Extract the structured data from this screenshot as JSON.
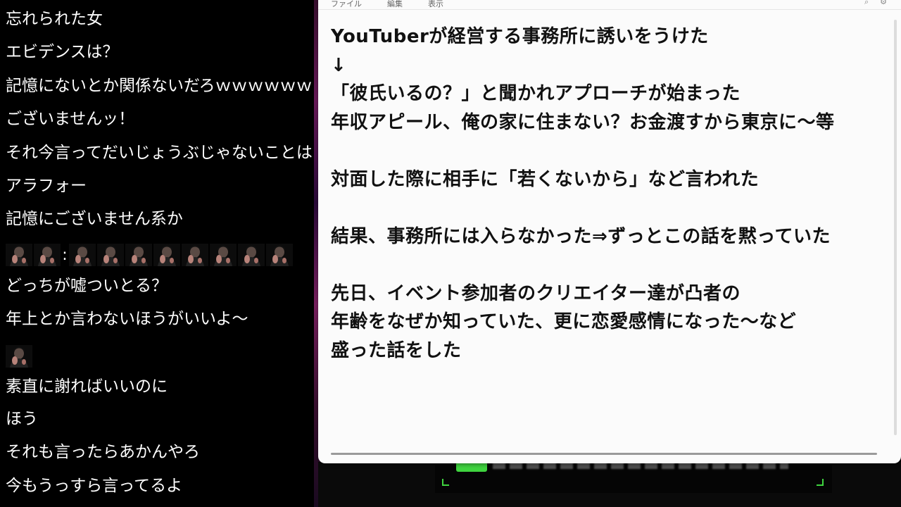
{
  "chat": {
    "messages": [
      "忘れられた女",
      "エビデンスは？",
      "記憶にないとか関係ないだろｗｗｗｗｗｗ",
      "ございませんッ！",
      "それ今言ってだいじょうぶじゃないことは",
      "アラフォー",
      "記憶にございません系か",
      "",
      "どっちが嘘ついとる？",
      "年上とか言わないほうがいいよ～",
      "",
      "素直に謝ればいいのに",
      "ほう",
      "それも言ったらあかんやろ",
      "今もうっすら言ってるよ"
    ],
    "emote_separator": ":"
  },
  "notepad": {
    "menu": [
      "ファイル",
      "編集",
      "表示"
    ],
    "lines": [
      "YouTuberが経営する事務所に誘いをうけた",
      "↓",
      "「彼氏いるの？」と聞かれアプローチが始まった",
      "年収アピール、俺の家に住まない？お金渡すから東京に～等",
      "",
      "対面した際に相手に「若くないから」など言われた",
      "",
      "結果、事務所には入らなかった⇒ずっとこの話を黙っていた",
      "",
      "先日、イベント参加者のクリエイター達が凸者の",
      "年齢をなぜか知っていた、更に恋愛感情になった～など",
      "盛った話をした"
    ]
  },
  "colors": {
    "chat_bg": "#000000",
    "chat_text": "#ffffff",
    "notepad_bg": "#fbfbfb",
    "notepad_text": "#111111",
    "accent_green": "#3fd43f"
  }
}
